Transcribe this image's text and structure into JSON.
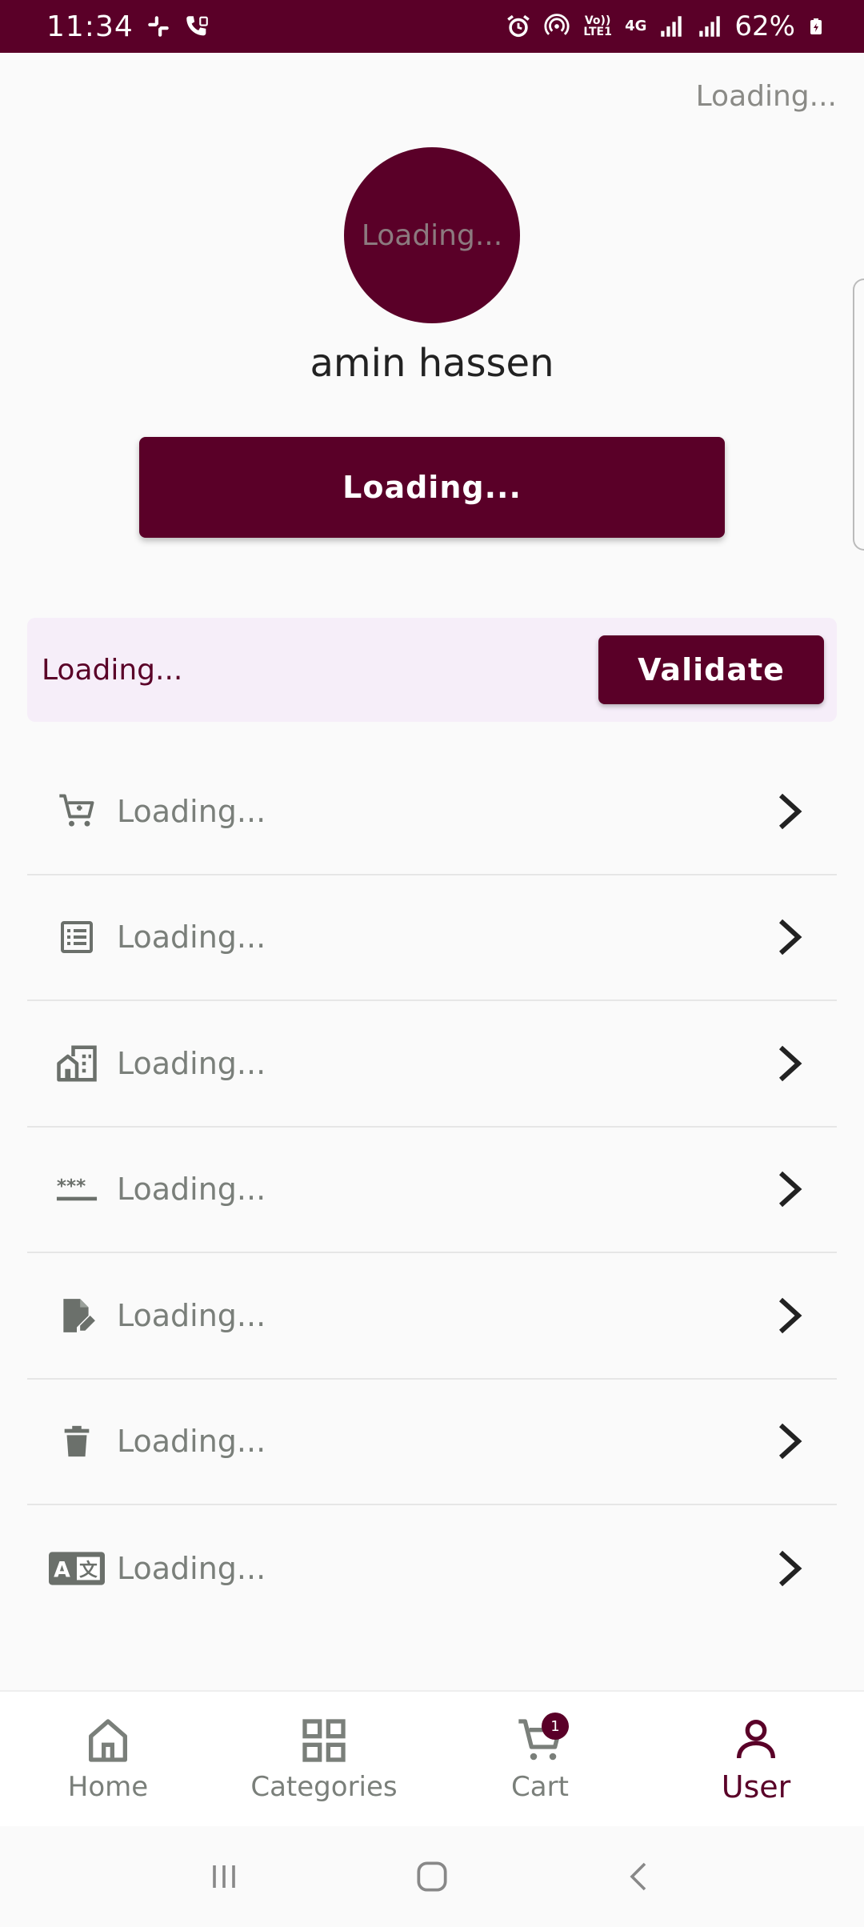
{
  "status_bar": {
    "time": "11:34",
    "signal_text_top": "Vo)) LTE1",
    "network": "4G",
    "battery": "62%"
  },
  "header": {
    "top_right_text": "Loading..."
  },
  "profile": {
    "avatar_text": "Loading...",
    "name": "amin hassen",
    "primary_button": "Loading..."
  },
  "validate": {
    "label": "Loading...",
    "button": "Validate"
  },
  "menu": {
    "items": [
      {
        "icon": "cart-icon",
        "label": "Loading..."
      },
      {
        "icon": "list-icon",
        "label": "Loading..."
      },
      {
        "icon": "building-icon",
        "label": "Loading..."
      },
      {
        "icon": "password-icon",
        "label": "Loading..."
      },
      {
        "icon": "edit-document-icon",
        "label": "Loading..."
      },
      {
        "icon": "trash-icon",
        "label": "Loading..."
      },
      {
        "icon": "translate-icon",
        "label": "Loading..."
      }
    ]
  },
  "bottom_nav": {
    "items": [
      {
        "label": "Home",
        "icon": "home-icon"
      },
      {
        "label": "Categories",
        "icon": "grid-icon"
      },
      {
        "label": "Cart",
        "icon": "cart-icon",
        "badge": "1"
      },
      {
        "label": "User",
        "icon": "user-icon",
        "active": true
      }
    ]
  },
  "colors": {
    "primary": "#5a0028",
    "surface": "#fafafa",
    "card": "#f6eef9",
    "muted": "#7a7f7a"
  }
}
